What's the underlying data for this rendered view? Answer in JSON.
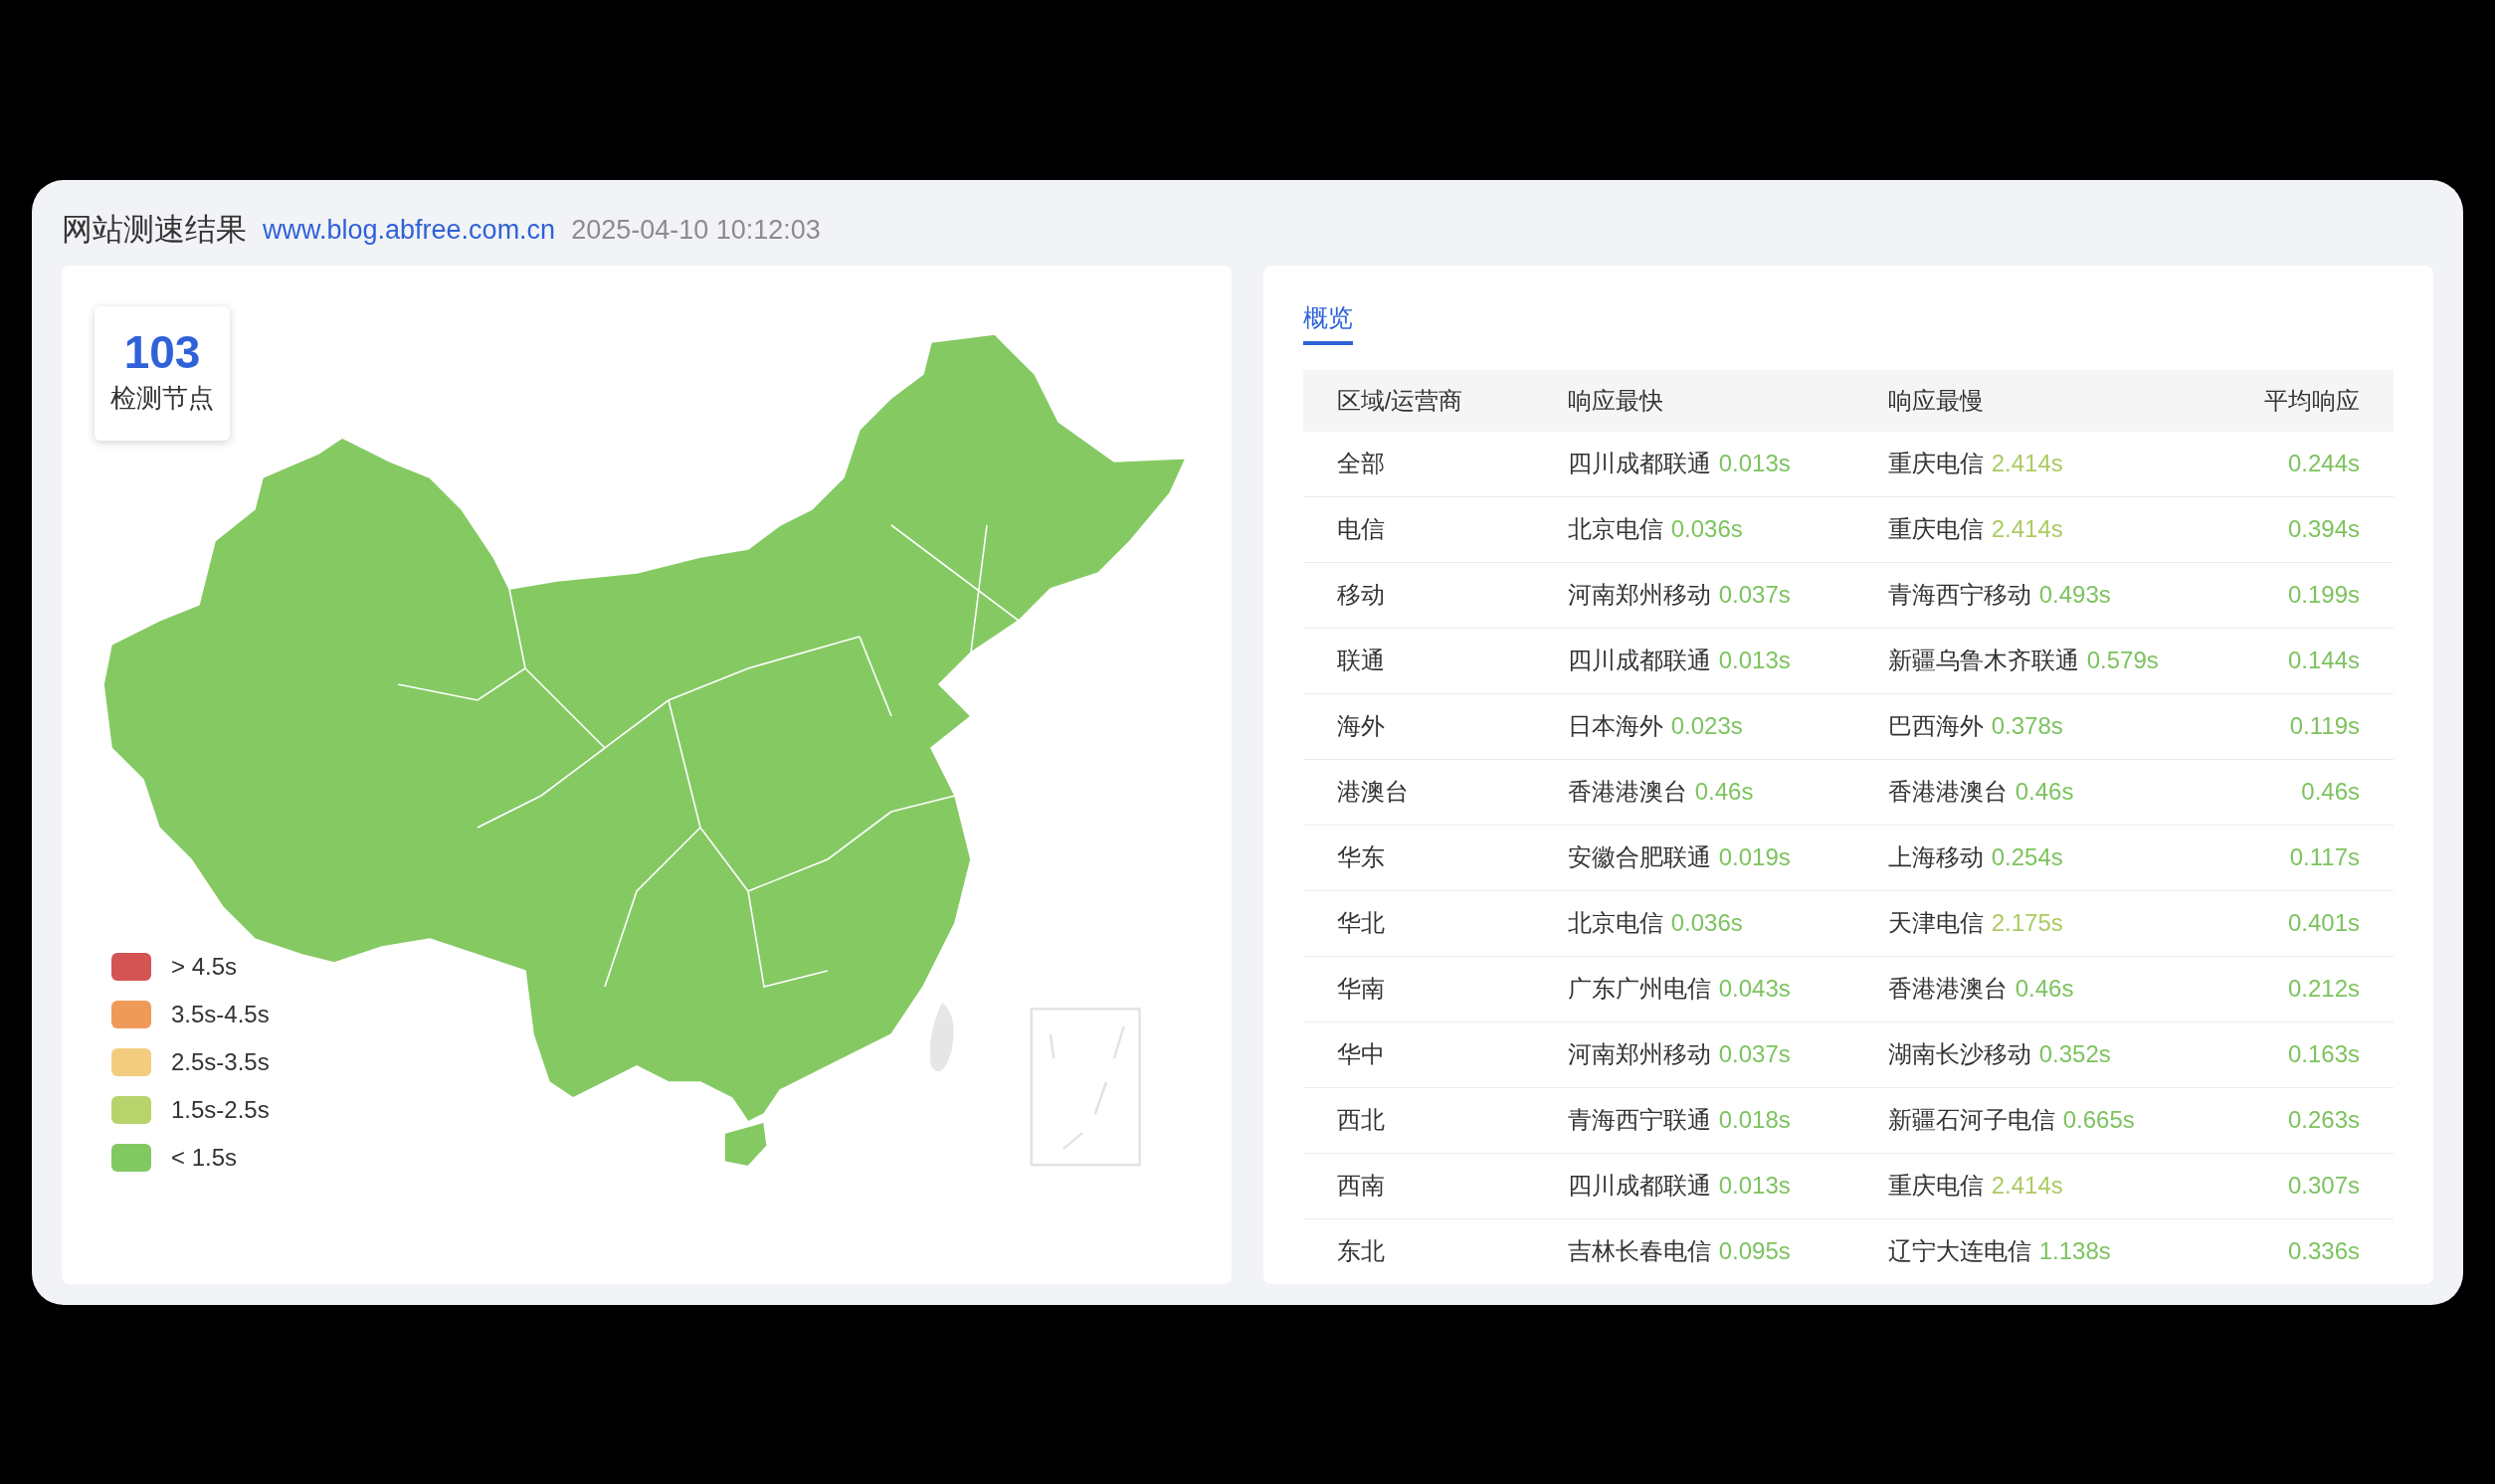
{
  "header": {
    "title": "网站测速结果",
    "url": "www.blog.abfree.com.cn",
    "timestamp": "2025-04-10 10:12:03"
  },
  "node_count": {
    "value": "103",
    "label": "检测节点"
  },
  "legend": [
    {
      "label": "> 4.5s",
      "color": "#d45454"
    },
    {
      "label": "3.5s-4.5s",
      "color": "#f09a5a"
    },
    {
      "label": "2.5s-3.5s",
      "color": "#f3cd7e"
    },
    {
      "label": "1.5s-2.5s",
      "color": "#b7d46c"
    },
    {
      "label": "< 1.5s",
      "color": "#82c862"
    }
  ],
  "tabs": [
    {
      "label": "概览",
      "selected": true
    }
  ],
  "table": {
    "columns": [
      "区域/运营商",
      "响应最快",
      "响应最慢",
      "平均响应"
    ],
    "rows": [
      {
        "region": "全部",
        "fastest": {
          "name": "四川成都联通",
          "time": "0.013s",
          "color": "#7cc35e"
        },
        "slowest": {
          "name": "重庆电信",
          "time": "2.414s",
          "color": "#abcb62"
        },
        "average": {
          "time": "0.244s",
          "color": "#7cc35e"
        }
      },
      {
        "region": "电信",
        "fastest": {
          "name": "北京电信",
          "time": "0.036s",
          "color": "#7cc35e"
        },
        "slowest": {
          "name": "重庆电信",
          "time": "2.414s",
          "color": "#abcb62"
        },
        "average": {
          "time": "0.394s",
          "color": "#7cc35e"
        }
      },
      {
        "region": "移动",
        "fastest": {
          "name": "河南郑州移动",
          "time": "0.037s",
          "color": "#7cc35e"
        },
        "slowest": {
          "name": "青海西宁移动",
          "time": "0.493s",
          "color": "#7cc35e"
        },
        "average": {
          "time": "0.199s",
          "color": "#7cc35e"
        }
      },
      {
        "region": "联通",
        "fastest": {
          "name": "四川成都联通",
          "time": "0.013s",
          "color": "#7cc35e"
        },
        "slowest": {
          "name": "新疆乌鲁木齐联通",
          "time": "0.579s",
          "color": "#7cc35e"
        },
        "average": {
          "time": "0.144s",
          "color": "#7cc35e"
        }
      },
      {
        "region": "海外",
        "fastest": {
          "name": "日本海外",
          "time": "0.023s",
          "color": "#7cc35e"
        },
        "slowest": {
          "name": "巴西海外",
          "time": "0.378s",
          "color": "#7cc35e"
        },
        "average": {
          "time": "0.119s",
          "color": "#7cc35e"
        }
      },
      {
        "region": "港澳台",
        "fastest": {
          "name": "香港港澳台",
          "time": "0.46s",
          "color": "#7cc35e"
        },
        "slowest": {
          "name": "香港港澳台",
          "time": "0.46s",
          "color": "#7cc35e"
        },
        "average": {
          "time": "0.46s",
          "color": "#7cc35e"
        }
      },
      {
        "region": "华东",
        "fastest": {
          "name": "安徽合肥联通",
          "time": "0.019s",
          "color": "#7cc35e"
        },
        "slowest": {
          "name": "上海移动",
          "time": "0.254s",
          "color": "#7cc35e"
        },
        "average": {
          "time": "0.117s",
          "color": "#7cc35e"
        }
      },
      {
        "region": "华北",
        "fastest": {
          "name": "北京电信",
          "time": "0.036s",
          "color": "#7cc35e"
        },
        "slowest": {
          "name": "天津电信",
          "time": "2.175s",
          "color": "#abcb62"
        },
        "average": {
          "time": "0.401s",
          "color": "#7cc35e"
        }
      },
      {
        "region": "华南",
        "fastest": {
          "name": "广东广州电信",
          "time": "0.043s",
          "color": "#7cc35e"
        },
        "slowest": {
          "name": "香港港澳台",
          "time": "0.46s",
          "color": "#7cc35e"
        },
        "average": {
          "time": "0.212s",
          "color": "#7cc35e"
        }
      },
      {
        "region": "华中",
        "fastest": {
          "name": "河南郑州移动",
          "time": "0.037s",
          "color": "#7cc35e"
        },
        "slowest": {
          "name": "湖南长沙移动",
          "time": "0.352s",
          "color": "#7cc35e"
        },
        "average": {
          "time": "0.163s",
          "color": "#7cc35e"
        }
      },
      {
        "region": "西北",
        "fastest": {
          "name": "青海西宁联通",
          "time": "0.018s",
          "color": "#7cc35e"
        },
        "slowest": {
          "name": "新疆石河子电信",
          "time": "0.665s",
          "color": "#7cc35e"
        },
        "average": {
          "time": "0.263s",
          "color": "#7cc35e"
        }
      },
      {
        "region": "西南",
        "fastest": {
          "name": "四川成都联通",
          "time": "0.013s",
          "color": "#7cc35e"
        },
        "slowest": {
          "name": "重庆电信",
          "time": "2.414s",
          "color": "#abcb62"
        },
        "average": {
          "time": "0.307s",
          "color": "#7cc35e"
        }
      },
      {
        "region": "东北",
        "fastest": {
          "name": "吉林长春电信",
          "time": "0.095s",
          "color": "#7cc35e"
        },
        "slowest": {
          "name": "辽宁大连电信",
          "time": "1.138s",
          "color": "#7cc35e"
        },
        "average": {
          "time": "0.336s",
          "color": "#7cc35e"
        }
      }
    ]
  }
}
